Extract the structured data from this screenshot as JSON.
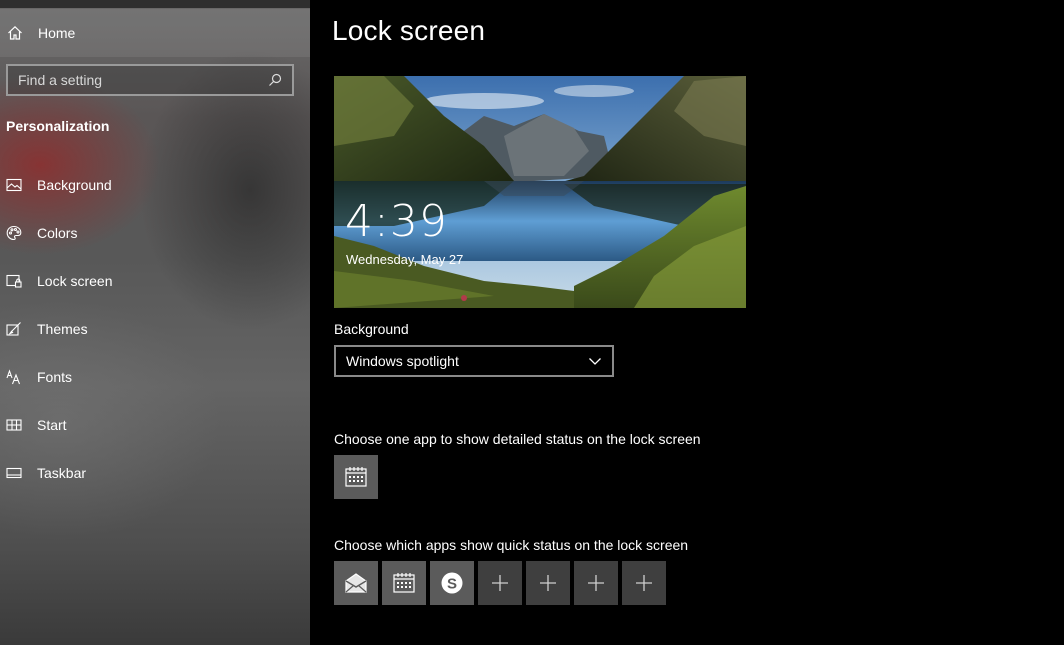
{
  "sidebar": {
    "home_label": "Home",
    "search": {
      "placeholder": "Find a setting"
    },
    "section_title": "Personalization",
    "items": [
      {
        "label": "Background",
        "icon": "picture-icon"
      },
      {
        "label": "Colors",
        "icon": "palette-icon"
      },
      {
        "label": "Lock screen",
        "icon": "lock-screen-icon"
      },
      {
        "label": "Themes",
        "icon": "themes-icon"
      },
      {
        "label": "Fonts",
        "icon": "fonts-icon"
      },
      {
        "label": "Start",
        "icon": "start-icon"
      },
      {
        "label": "Taskbar",
        "icon": "taskbar-icon"
      }
    ]
  },
  "main": {
    "title": "Lock screen",
    "preview": {
      "time": "4:39",
      "date": "Wednesday, May 27"
    },
    "background_label": "Background",
    "background_value": "Windows spotlight",
    "detailed_status_label": "Choose one app to show detailed status on the lock screen",
    "detailed_status_apps": [
      {
        "icon": "calendar-icon"
      }
    ],
    "quick_status_label": "Choose which apps show quick status on the lock screen",
    "quick_status_apps": [
      {
        "icon": "mail-icon"
      },
      {
        "icon": "calendar-icon"
      },
      {
        "icon": "skype-icon"
      },
      {
        "icon": "plus-icon"
      },
      {
        "icon": "plus-icon"
      },
      {
        "icon": "plus-icon"
      },
      {
        "icon": "plus-icon"
      }
    ]
  },
  "colors": {
    "sidebar_bg": "#5e5e5e",
    "main_bg": "#000000",
    "tile_bg": "#5b5b5b",
    "add_tile_bg": "#3f3f3f"
  }
}
